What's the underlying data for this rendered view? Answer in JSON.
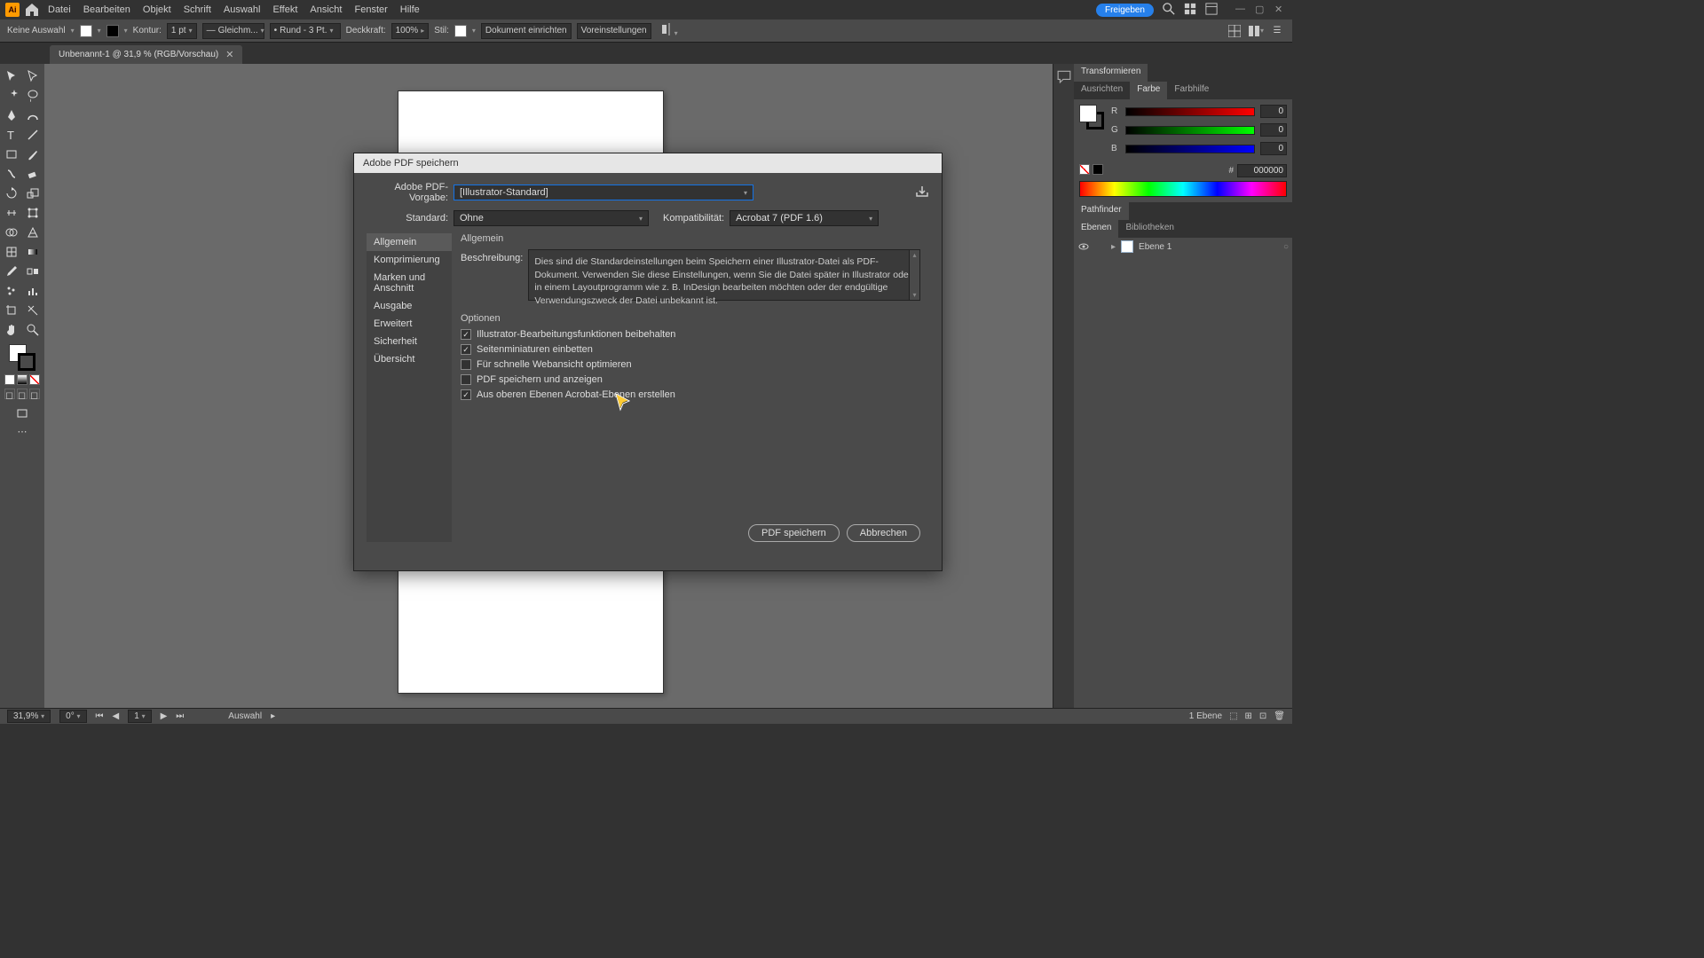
{
  "titlebar": {
    "logo": "Ai",
    "menu": [
      "Datei",
      "Bearbeiten",
      "Objekt",
      "Schrift",
      "Auswahl",
      "Effekt",
      "Ansicht",
      "Fenster",
      "Hilfe"
    ],
    "share": "Freigeben"
  },
  "optionsbar": {
    "noselection": "Keine Auswahl",
    "kontur": "Kontur:",
    "stroke_width": "1 pt",
    "stroke_style": "Gleichm...",
    "cap_style": "Rund - 3 Pt.",
    "opacity_label": "Deckkraft:",
    "opacity": "100%",
    "stil": "Stil:",
    "doc_setup": "Dokument einrichten",
    "prefs": "Voreinstellungen"
  },
  "doc_tab": {
    "title": "Unbenannt-1 @ 31,9 % (RGB/Vorschau)"
  },
  "right_panels": {
    "transform_tab": "Transformieren",
    "color_tabs": [
      "Ausrichten",
      "Farbe",
      "Farbhilfe"
    ],
    "rgb": {
      "r": "0",
      "g": "0",
      "b": "0"
    },
    "hex": "000000",
    "pathfinder_tab": "Pathfinder",
    "layers_tabs": [
      "Ebenen",
      "Bibliotheken"
    ],
    "layer1": "Ebene 1",
    "layer_footer": "1 Ebene"
  },
  "statusbar": {
    "zoom": "31,9%",
    "rotate": "0°",
    "artboard": "1",
    "tool": "Auswahl"
  },
  "dialog": {
    "title": "Adobe PDF speichern",
    "preset_label": "Adobe PDF-Vorgabe:",
    "preset_value": "[Illustrator-Standard]",
    "standard_label": "Standard:",
    "standard_value": "Ohne",
    "compat_label": "Kompatibilität:",
    "compat_value": "Acrobat 7 (PDF 1.6)",
    "sidebar": [
      "Allgemein",
      "Komprimierung",
      "Marken und Anschnitt",
      "Ausgabe",
      "Erweitert",
      "Sicherheit",
      "Übersicht"
    ],
    "section_general": "Allgemein",
    "desc_label": "Beschreibung:",
    "desc_text": "Dies sind die Standardeinstellungen beim Speichern einer Illustrator-Datei als PDF-Dokument. Verwenden Sie diese Einstellungen, wenn Sie die Datei später in Illustrator oder in einem Layoutprogramm wie z. B. InDesign bearbeiten möchten oder der endgültige Verwendungszweck der Datei unbekannt ist.",
    "options_title": "Optionen",
    "cb1": "Illustrator-Bearbeitungsfunktionen beibehalten",
    "cb2": "Seitenminiaturen einbetten",
    "cb3": "Für schnelle Webansicht optimieren",
    "cb4": "PDF speichern und anzeigen",
    "cb5": "Aus oberen Ebenen Acrobat-Ebenen erstellen",
    "btn_save": "PDF speichern",
    "btn_cancel": "Abbrechen"
  }
}
